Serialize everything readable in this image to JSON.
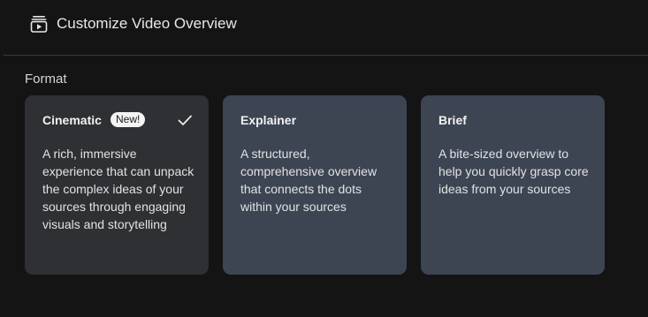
{
  "header": {
    "icon": "video-overview-icon",
    "title": "Customize Video Overview"
  },
  "format": {
    "label": "Format",
    "options": [
      {
        "title": "Cinematic",
        "badge": "New!",
        "selected": true,
        "description": "A rich, immersive experience that can unpack the complex ideas of your sources through engaging visuals and storytelling"
      },
      {
        "title": "Explainer",
        "selected": false,
        "description": "A structured, comprehensive overview that connects the dots within your sources"
      },
      {
        "title": "Brief",
        "selected": false,
        "description": "A bite-sized overview to help you quickly grasp core ideas from your sources"
      }
    ]
  },
  "colors": {
    "background": "#141414",
    "selected_card": "#2f3034",
    "unselected_card": "#3d4553",
    "badge": "#f4f4f4"
  }
}
